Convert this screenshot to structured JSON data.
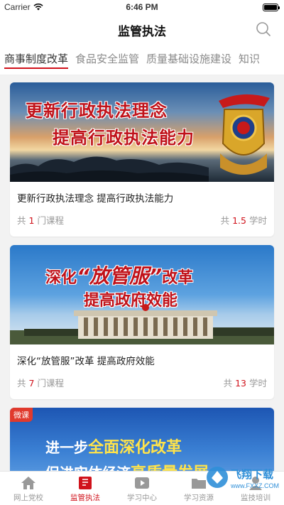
{
  "status_bar": {
    "carrier": "Carrier",
    "time": "6:46 PM"
  },
  "nav": {
    "title": "监管执法",
    "search_icon": "search-icon"
  },
  "tabs": [
    {
      "label": "商事制度改革",
      "active": true
    },
    {
      "label": "食品安全监管",
      "active": false
    },
    {
      "label": "质量基础设施建设",
      "active": false
    },
    {
      "label": "知识",
      "active": false
    }
  ],
  "cards": [
    {
      "banner_line1": "更新行政执法理念",
      "banner_line2": "提高行政执法能力",
      "title": "更新行政执法理念 提高行政执法能力",
      "courses_prefix": "共",
      "courses_count": "1",
      "courses_suffix": "门课程",
      "hours_prefix": "共",
      "hours_value": "1.5",
      "hours_suffix": "学时"
    },
    {
      "banner_line1_a": "深化",
      "banner_line1_b": "“放管服”",
      "banner_line1_c": "改革",
      "banner_line2": "提高政府效能",
      "title": "深化“放管服”改革 提高政府效能",
      "courses_prefix": "共",
      "courses_count": "7",
      "courses_suffix": "门课程",
      "hours_prefix": "共",
      "hours_value": "13",
      "hours_suffix": "学时"
    },
    {
      "badge": "微课",
      "banner_line1_a": "进一步",
      "banner_line1_b": "全面深化改革",
      "banner_line2_a": "促进实体经济",
      "banner_line2_b": "高质量发展"
    }
  ],
  "tabbar": [
    {
      "label": "网上党校",
      "icon": "home-icon",
      "active": false
    },
    {
      "label": "监管执法",
      "icon": "book-icon",
      "active": true
    },
    {
      "label": "学习中心",
      "icon": "play-icon",
      "active": false
    },
    {
      "label": "学习资源",
      "icon": "folder-icon",
      "active": false
    },
    {
      "label": "监技培训",
      "icon": "person-icon",
      "active": false
    }
  ],
  "watermark": {
    "text_cn": "飞翔下载",
    "text_en": "www.FXXZ.COM"
  },
  "colors": {
    "accent": "#d0121b",
    "tab_inactive": "#8a8a8a"
  }
}
